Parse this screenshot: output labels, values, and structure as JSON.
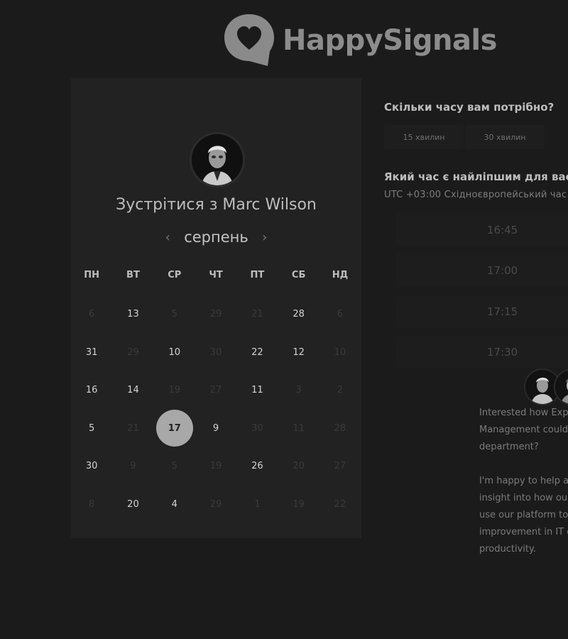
{
  "logo": {
    "text": "HappySignals",
    "icon": "heart-speech-bubble-icon"
  },
  "host": {
    "title": "Зустрітися з Marc Wilson"
  },
  "calendar": {
    "month": "серпень",
    "prev_icon": "chevron-left-icon",
    "next_icon": "chevron-right-icon",
    "weekdays": [
      "ПН",
      "ВТ",
      "СР",
      "ЧТ",
      "ПТ",
      "СБ",
      "НД"
    ],
    "weeks": [
      [
        {
          "d": "6",
          "s": "dim"
        },
        {
          "d": "13",
          "s": "on"
        },
        {
          "d": "5",
          "s": "dim"
        },
        {
          "d": "29",
          "s": "dim"
        },
        {
          "d": "21",
          "s": "dim"
        },
        {
          "d": "28",
          "s": "on"
        },
        {
          "d": "6",
          "s": "dim"
        }
      ],
      [
        {
          "d": "31",
          "s": "on"
        },
        {
          "d": "29",
          "s": "dim"
        },
        {
          "d": "10",
          "s": "on"
        },
        {
          "d": "30",
          "s": "dim"
        },
        {
          "d": "22",
          "s": "on"
        },
        {
          "d": "12",
          "s": "on"
        },
        {
          "d": "10",
          "s": "dim"
        }
      ],
      [
        {
          "d": "16",
          "s": "on"
        },
        {
          "d": "14",
          "s": "on"
        },
        {
          "d": "19",
          "s": "dim"
        },
        {
          "d": "27",
          "s": "dim"
        },
        {
          "d": "11",
          "s": "on"
        },
        {
          "d": "3",
          "s": "dim"
        },
        {
          "d": "2",
          "s": "dim"
        }
      ],
      [
        {
          "d": "5",
          "s": "on"
        },
        {
          "d": "21",
          "s": "dim"
        },
        {
          "d": "17",
          "s": "sel"
        },
        {
          "d": "9",
          "s": "on"
        },
        {
          "d": "30",
          "s": "dim"
        },
        {
          "d": "11",
          "s": "dim"
        },
        {
          "d": "28",
          "s": "dim"
        }
      ],
      [
        {
          "d": "30",
          "s": "on"
        },
        {
          "d": "9",
          "s": "dim"
        },
        {
          "d": "5",
          "s": "dim"
        },
        {
          "d": "19",
          "s": "dim"
        },
        {
          "d": "26",
          "s": "on"
        },
        {
          "d": "20",
          "s": "dim"
        },
        {
          "d": "27",
          "s": "dim"
        }
      ],
      [
        {
          "d": "8",
          "s": "dim"
        },
        {
          "d": "20",
          "s": "on"
        },
        {
          "d": "4",
          "s": "on"
        },
        {
          "d": "29",
          "s": "dim"
        },
        {
          "d": "1",
          "s": "dim"
        },
        {
          "d": "19",
          "s": "dim"
        },
        {
          "d": "22",
          "s": "dim"
        }
      ]
    ]
  },
  "duration": {
    "question": "Скільки часу вам потрібно?",
    "options": [
      "15 хвилин",
      "30 хвилин"
    ]
  },
  "time": {
    "question": "Який час є найліпшим для вас?",
    "timezone": "UTC +03:00 Східноєвропейський час",
    "slots": [
      "16:45",
      "17:00",
      "17:15",
      "17:30"
    ]
  },
  "bio": {
    "lines": [
      "Interested how Experience",
      "Management could help your",
      "department?",
      "",
      "I'm happy to help and give",
      "insight into how our customers",
      "use our platform to drive",
      "improvement in IT experience and",
      "productivity."
    ]
  }
}
